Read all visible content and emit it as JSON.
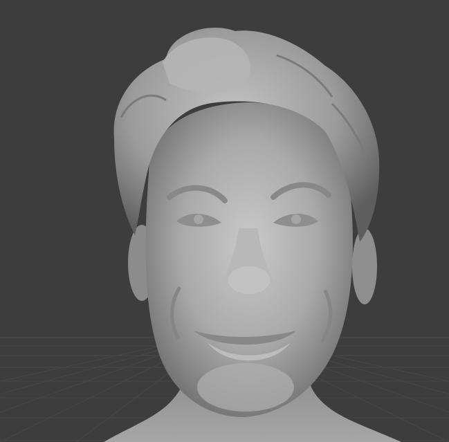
{
  "viewport": {
    "background_color": "#3d3d3d",
    "grid_color": "#4a4a4a",
    "model_color": "#9a9a9a",
    "model_highlight_color": "#c4c4c4",
    "model_shadow_color": "#6b6b6b",
    "grid_visible": true,
    "shading_mode": "solid",
    "subject": "sculpted-head-bust"
  }
}
